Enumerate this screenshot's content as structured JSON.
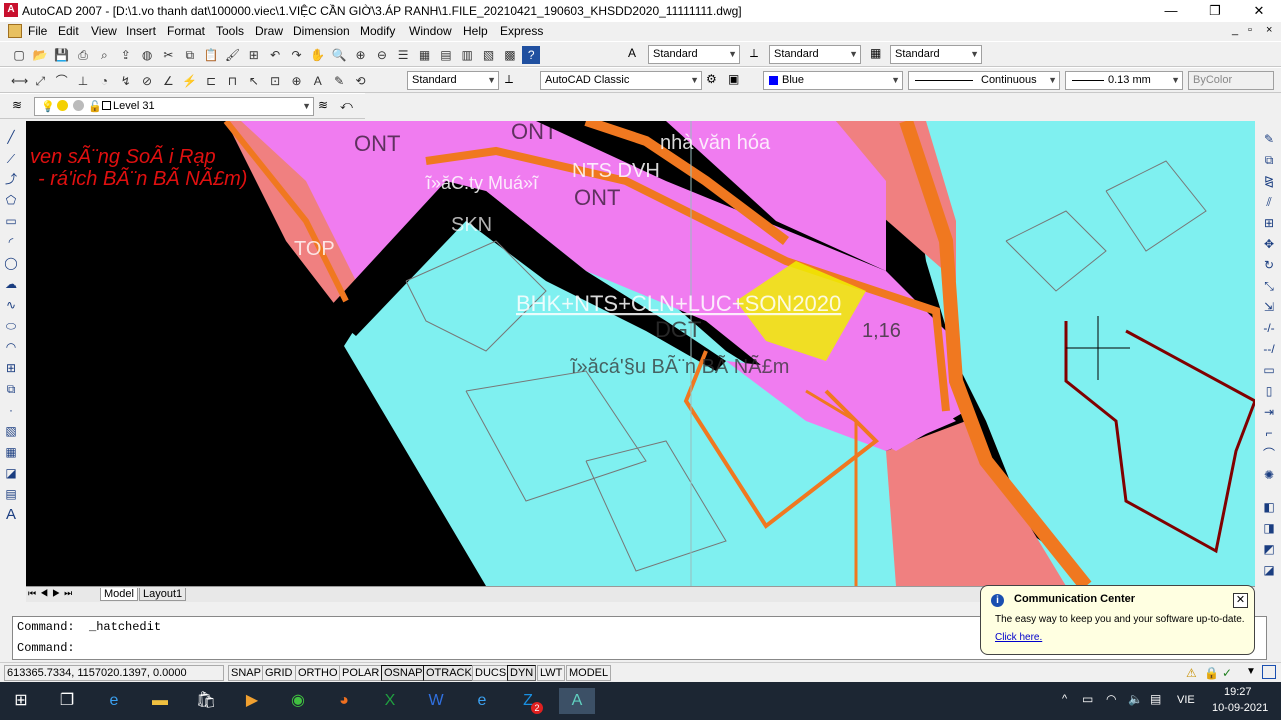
{
  "window": {
    "title": "AutoCAD 2007 - [D:\\1.vo thanh dat\\100000.viec\\1.VIỆC CẦN GIỜ\\3.ÁP RANH\\1.FILE_20210421_190603_KHSDD2020_11111111.dwg]",
    "minimize": "—",
    "restore": "❐",
    "close": "✕"
  },
  "menu": [
    "File",
    "Edit",
    "View",
    "Insert",
    "Format",
    "Tools",
    "Draw",
    "Dimension",
    "Modify",
    "Window",
    "Help",
    "Express"
  ],
  "styles": {
    "text_style": "Standard",
    "dim_style": "Standard",
    "table_style": "Standard",
    "workspace": "AutoCAD Classic",
    "layer": "Level 31",
    "color": "Blue",
    "linetype": "Continuous",
    "lineweight": "0.13 mm",
    "plotstyle": "ByColor"
  },
  "drawing_labels": {
    "ont1": "ONT",
    "ont2": "ONT",
    "ont3": "ONT",
    "nha_van_hoa": "nhà văn hóa",
    "nts_dvh": "NTS  DVH",
    "top": "TOP",
    "skn": "SKN",
    "cty": "ĩ»ăC.ty Muá»ĩ",
    "ven_song": "ven sÃ¨ng SoÃ i Rạp",
    "rach": "- rá'ich BÃ¨n BÃ  NÃ£m)",
    "bhk": "BHK+NTS+CLN+LUC+SON2020",
    "dgt": "DGT",
    "val": "1,16",
    "ku_ben": "ĩ»ăcá'§u BÃ¨n BÃ  NÃ£m"
  },
  "tabs": {
    "model": "Model",
    "layout1": "Layout1"
  },
  "command": {
    "line1": "Command:  _hatchedit",
    "line2": "Command:"
  },
  "status": {
    "coords": "613365.7334, 1157020.1397, 0.0000",
    "buttons": [
      "SNAP",
      "GRID",
      "ORTHO",
      "POLAR",
      "OSNAP",
      "OTRACK",
      "DUCS",
      "DYN",
      "LWT",
      "MODEL"
    ]
  },
  "comm_center": {
    "title": "Communication Center",
    "body": "The easy way to keep you and your software up-to-date.",
    "link": "Click here."
  },
  "taskbar": {
    "lang": "VIE",
    "time": "19:27",
    "date": "10-09-2021",
    "badge": "2"
  }
}
